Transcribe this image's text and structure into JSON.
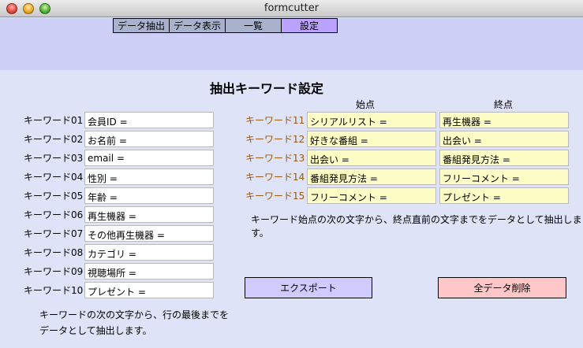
{
  "window": {
    "title": "formcutter"
  },
  "tabs": [
    {
      "label": "データ抽出"
    },
    {
      "label": "データ表示"
    },
    {
      "label": "一覧"
    },
    {
      "label": "設定"
    }
  ],
  "page": {
    "heading": "抽出キーワード設定",
    "start_header": "始点",
    "end_header": "終点"
  },
  "left_keywords": [
    {
      "label": "キーワード01",
      "value": "会員ID ="
    },
    {
      "label": "キーワード02",
      "value": "お名前 ="
    },
    {
      "label": "キーワード03",
      "value": "email ="
    },
    {
      "label": "キーワード04",
      "value": "性別 ="
    },
    {
      "label": "キーワード05",
      "value": "年齢 ="
    },
    {
      "label": "キーワード06",
      "value": "再生機器 ="
    },
    {
      "label": "キーワード07",
      "value": "その他再生機器 ="
    },
    {
      "label": "キーワード08",
      "value": "カテゴリ ="
    },
    {
      "label": "キーワード09",
      "value": "視聴場所 ="
    },
    {
      "label": "キーワード10",
      "value": "プレゼント ="
    }
  ],
  "right_keywords": [
    {
      "label": "キーワード11",
      "start": "シリアルリスト =",
      "end": "再生機器 ="
    },
    {
      "label": "キーワード12",
      "start": "好きな番組 =",
      "end": "出会い ="
    },
    {
      "label": "キーワード13",
      "start": "出会い =",
      "end": "番組発見方法 ="
    },
    {
      "label": "キーワード14",
      "start": "番組発見方法 =",
      "end": "フリーコメント ="
    },
    {
      "label": "キーワード15",
      "start": "フリーコメント =",
      "end": "プレゼント ="
    }
  ],
  "notes": {
    "right": "キーワード始点の次の文字から、終点直前の文字までをデータとして抽出します。",
    "left_line1": "キーワードの次の文字から、行の最後までを",
    "left_line2": "データとして抽出します。"
  },
  "buttons": {
    "export": "エクスポート",
    "delete_all": "全データ削除"
  },
  "colors": {
    "active_tab": "#bba2ff",
    "inactive_tab": "#a9b2cc",
    "header_bg": "#cccff6",
    "content_bg": "#dfe3f8",
    "yellow_field": "#fffdc6",
    "orange_label": "#9a5a10",
    "export_button": "#cfcbff",
    "delete_button": "#ffc7c7"
  }
}
